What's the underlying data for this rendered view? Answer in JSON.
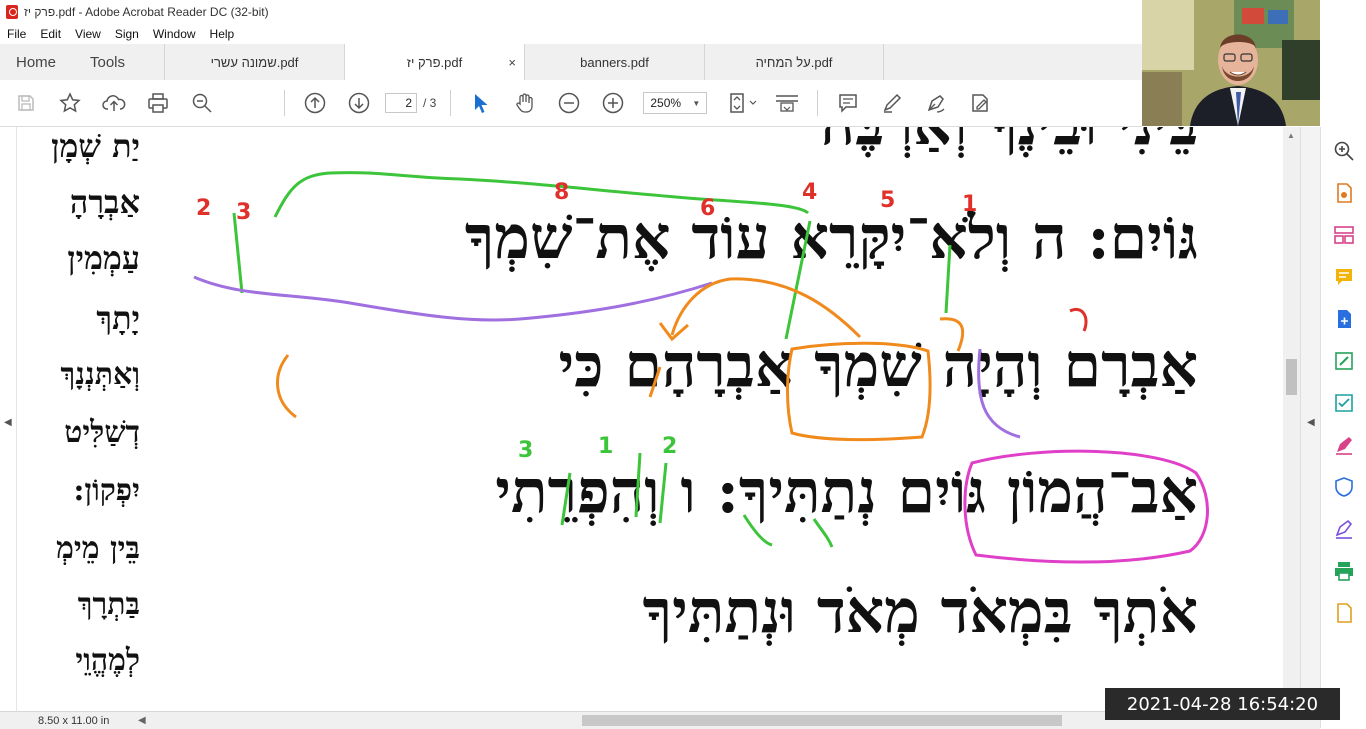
{
  "window": {
    "title": "פרק יז.pdf - Adobe Acrobat Reader DC (32-bit)"
  },
  "menu": [
    "File",
    "Edit",
    "View",
    "Sign",
    "Window",
    "Help"
  ],
  "tabs": {
    "home": "Home",
    "tools": "Tools",
    "docs": [
      {
        "label": "שמונה עשרי.pdf",
        "active": false
      },
      {
        "label": "פרק יז.pdf",
        "active": true,
        "close": "×"
      },
      {
        "label": "banners.pdf",
        "active": false
      },
      {
        "label": "על המחיה.pdf",
        "active": false
      }
    ]
  },
  "toolbar": {
    "page_current": "2",
    "page_total": "/ 3",
    "zoom": "250%"
  },
  "document": {
    "side_lines": [
      "יַת שְׁמָן",
      "אַבְרָהָ",
      "עַמְמִין",
      "יָתָךְ",
      "וְאַתְּנְנָךְ",
      "דְשַׁלִּיט",
      "יִפְקוֹן:",
      "בֵּין מֵימְ",
      "בַּתְרָךְ",
      "לְמֶהֱוֵי"
    ],
    "main_lines": [
      "בֵּינִי וּבֵינֶךָ וְאַרְבֶּה",
      "גּוֹיִם: ה וְלֹא־יִקָּרֵא עוֹד אֶת־שִׁמְךָ",
      "אַבְרָם וְהָיָה שִׁמְךָ אַבְרָהָם כִּי",
      "אַב־הֲמוֹן גּוֹיִם נְתַתִּיךָ: ו וְהִפְרֵתִי",
      "אֹתְךָ בִּמְאֹד מְאֹד וּנְתַתִּיךָ"
    ]
  },
  "annotations": {
    "numbers": [
      "2",
      "3",
      "8",
      "6",
      "4",
      "5",
      "1",
      "3",
      "1",
      "2"
    ],
    "colors": {
      "red": "#e0302a",
      "green": "#3cc43a",
      "purple": "#a070e0",
      "orange": "#f08a1c",
      "pink": "#e040c8"
    }
  },
  "status": {
    "page_size": "8.50 x 11.00 in"
  },
  "overlay": {
    "timestamp": "2021-04-28  16:54:20"
  },
  "tool_rail_icons": [
    "zoom-search-icon",
    "export-pdf-icon",
    "organize-pages-icon",
    "comment-icon",
    "create-pdf-icon",
    "edit-pdf-icon",
    "enhance-scans-icon",
    "fill-sign-icon",
    "protect-icon",
    "sign-icon",
    "print-production-icon",
    "more-tools-icon"
  ]
}
